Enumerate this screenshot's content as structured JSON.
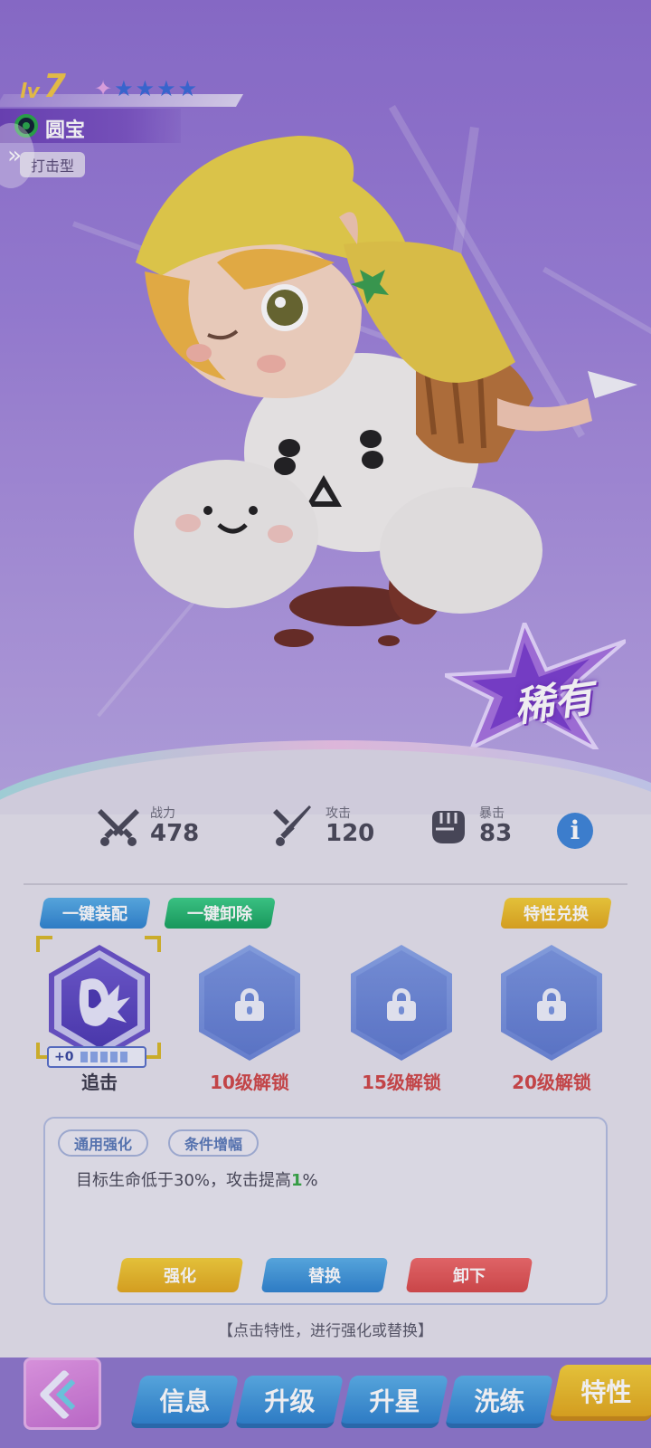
{
  "hero": {
    "level_label": "lv",
    "level": "7",
    "stars": 5,
    "star_colors": [
      "#e6a8e8",
      "#3a6bd8",
      "#3a6bd8",
      "#3a6bd8",
      "#3a6bd8"
    ],
    "name": "圆宝",
    "type": "打击型",
    "rarity": "稀有"
  },
  "stats": {
    "power_label": "战力",
    "power_value": "478",
    "attack_label": "攻击",
    "attack_value": "120",
    "crit_label": "暴击",
    "crit_value": "83",
    "info_icon": "i"
  },
  "actions": {
    "equip_all": "一键装配",
    "unequip_all": "一键卸除",
    "trait_exchange": "特性兑换"
  },
  "slots": [
    {
      "label": "追击",
      "state": "equipped",
      "plus": "+0"
    },
    {
      "label": "10级解锁",
      "state": "locked"
    },
    {
      "label": "15级解锁",
      "state": "locked"
    },
    {
      "label": "20级解锁",
      "state": "locked"
    }
  ],
  "detail": {
    "tags": [
      "通用强化",
      "条件增幅"
    ],
    "desc_prefix": "目标生命低于30%，攻击提高",
    "desc_highlight": "1",
    "desc_suffix": "%",
    "buttons": {
      "enhance": "强化",
      "replace": "替换",
      "remove": "卸下"
    },
    "hint": "【点击特性，进行强化或替换】"
  },
  "tabs": [
    "信息",
    "升级",
    "升星",
    "洗练",
    "特性"
  ],
  "colors": {
    "accent_gold": "#e2a91e",
    "accent_blue": "#2f84d0",
    "accent_green": "#22b06a",
    "accent_red": "#d84a4a",
    "locked_red": "#d04848"
  }
}
